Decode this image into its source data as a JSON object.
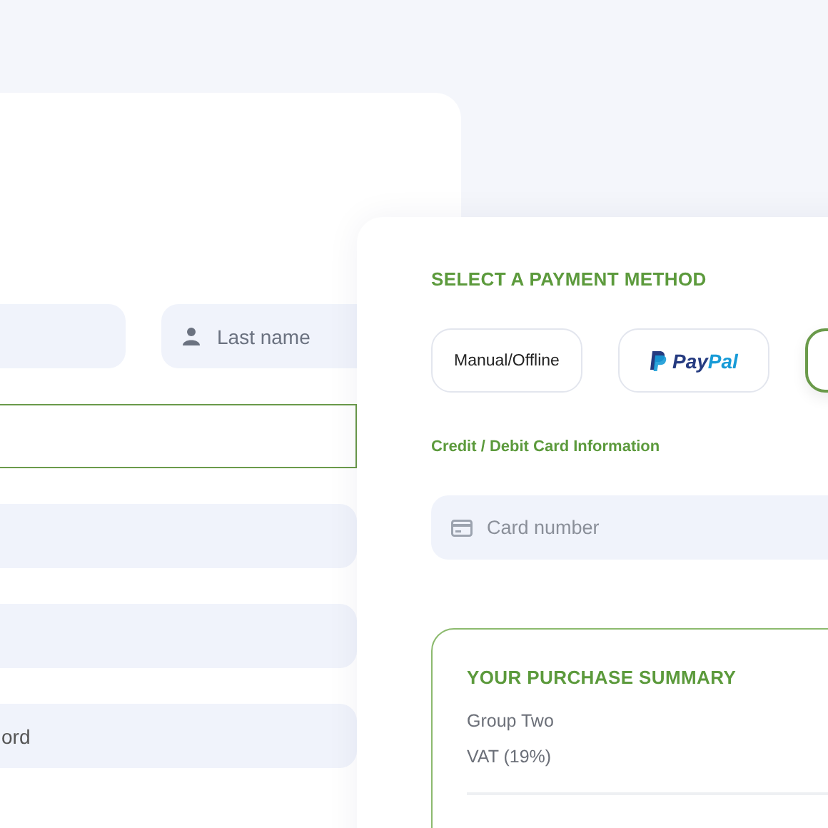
{
  "account_form": {
    "fields": [
      {
        "kind": "plain"
      },
      {
        "kind": "person",
        "placeholder": "Last name"
      },
      {
        "kind": "focused"
      },
      {
        "kind": "plain"
      },
      {
        "kind": "plain"
      },
      {
        "kind": "plain",
        "value": "ord"
      }
    ]
  },
  "payment": {
    "title": "SELECT A PAYMENT METHOD",
    "methods": [
      {
        "kind": "text",
        "label": "Manual/Offline",
        "selected": false
      },
      {
        "kind": "paypal",
        "label_parts": [
          "Pay",
          "Pal"
        ],
        "selected": false
      },
      {
        "kind": "blank",
        "selected": true
      }
    ],
    "card_section_label": "Credit / Debit Card Information",
    "card_field": {
      "placeholder": "Card number"
    },
    "summary": {
      "title": "YOUR PURCHASE SUMMARY",
      "lines": [
        "Group Two",
        "VAT (19%)"
      ]
    }
  }
}
